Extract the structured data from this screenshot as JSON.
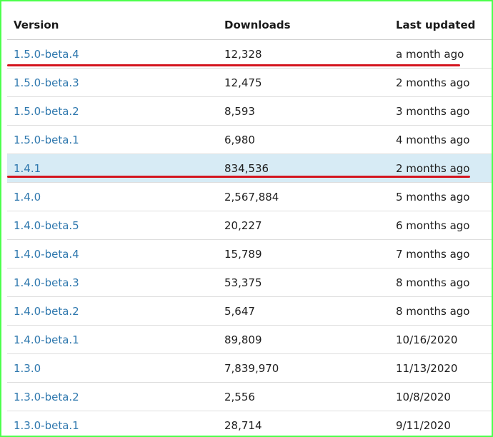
{
  "table": {
    "headers": {
      "version": "Version",
      "downloads": "Downloads",
      "last_updated": "Last updated"
    },
    "rows": [
      {
        "version": "1.5.0-beta.4",
        "downloads": "12,328",
        "last_updated": "a month ago",
        "highlighted": false
      },
      {
        "version": "1.5.0-beta.3",
        "downloads": "12,475",
        "last_updated": "2 months ago",
        "highlighted": false
      },
      {
        "version": "1.5.0-beta.2",
        "downloads": "8,593",
        "last_updated": "3 months ago",
        "highlighted": false
      },
      {
        "version": "1.5.0-beta.1",
        "downloads": "6,980",
        "last_updated": "4 months ago",
        "highlighted": false
      },
      {
        "version": "1.4.1",
        "downloads": "834,536",
        "last_updated": "2 months ago",
        "highlighted": true
      },
      {
        "version": "1.4.0",
        "downloads": "2,567,884",
        "last_updated": "5 months ago",
        "highlighted": false
      },
      {
        "version": "1.4.0-beta.5",
        "downloads": "20,227",
        "last_updated": "6 months ago",
        "highlighted": false
      },
      {
        "version": "1.4.0-beta.4",
        "downloads": "15,789",
        "last_updated": "7 months ago",
        "highlighted": false
      },
      {
        "version": "1.4.0-beta.3",
        "downloads": "53,375",
        "last_updated": "8 months ago",
        "highlighted": false
      },
      {
        "version": "1.4.0-beta.2",
        "downloads": "5,647",
        "last_updated": "8 months ago",
        "highlighted": false
      },
      {
        "version": "1.4.0-beta.1",
        "downloads": "89,809",
        "last_updated": "10/16/2020",
        "highlighted": false
      },
      {
        "version": "1.3.0",
        "downloads": "7,839,970",
        "last_updated": "11/13/2020",
        "highlighted": false
      },
      {
        "version": "1.3.0-beta.2",
        "downloads": "2,556",
        "last_updated": "10/8/2020",
        "highlighted": false
      },
      {
        "version": "1.3.0-beta.1",
        "downloads": "28,714",
        "last_updated": "9/11/2020",
        "highlighted": false
      }
    ]
  },
  "colors": {
    "link": "#2f78ae",
    "highlight_row": "#d7ebf5",
    "annotation_underline": "#d4141e",
    "frame_border": "#4cff4c"
  }
}
